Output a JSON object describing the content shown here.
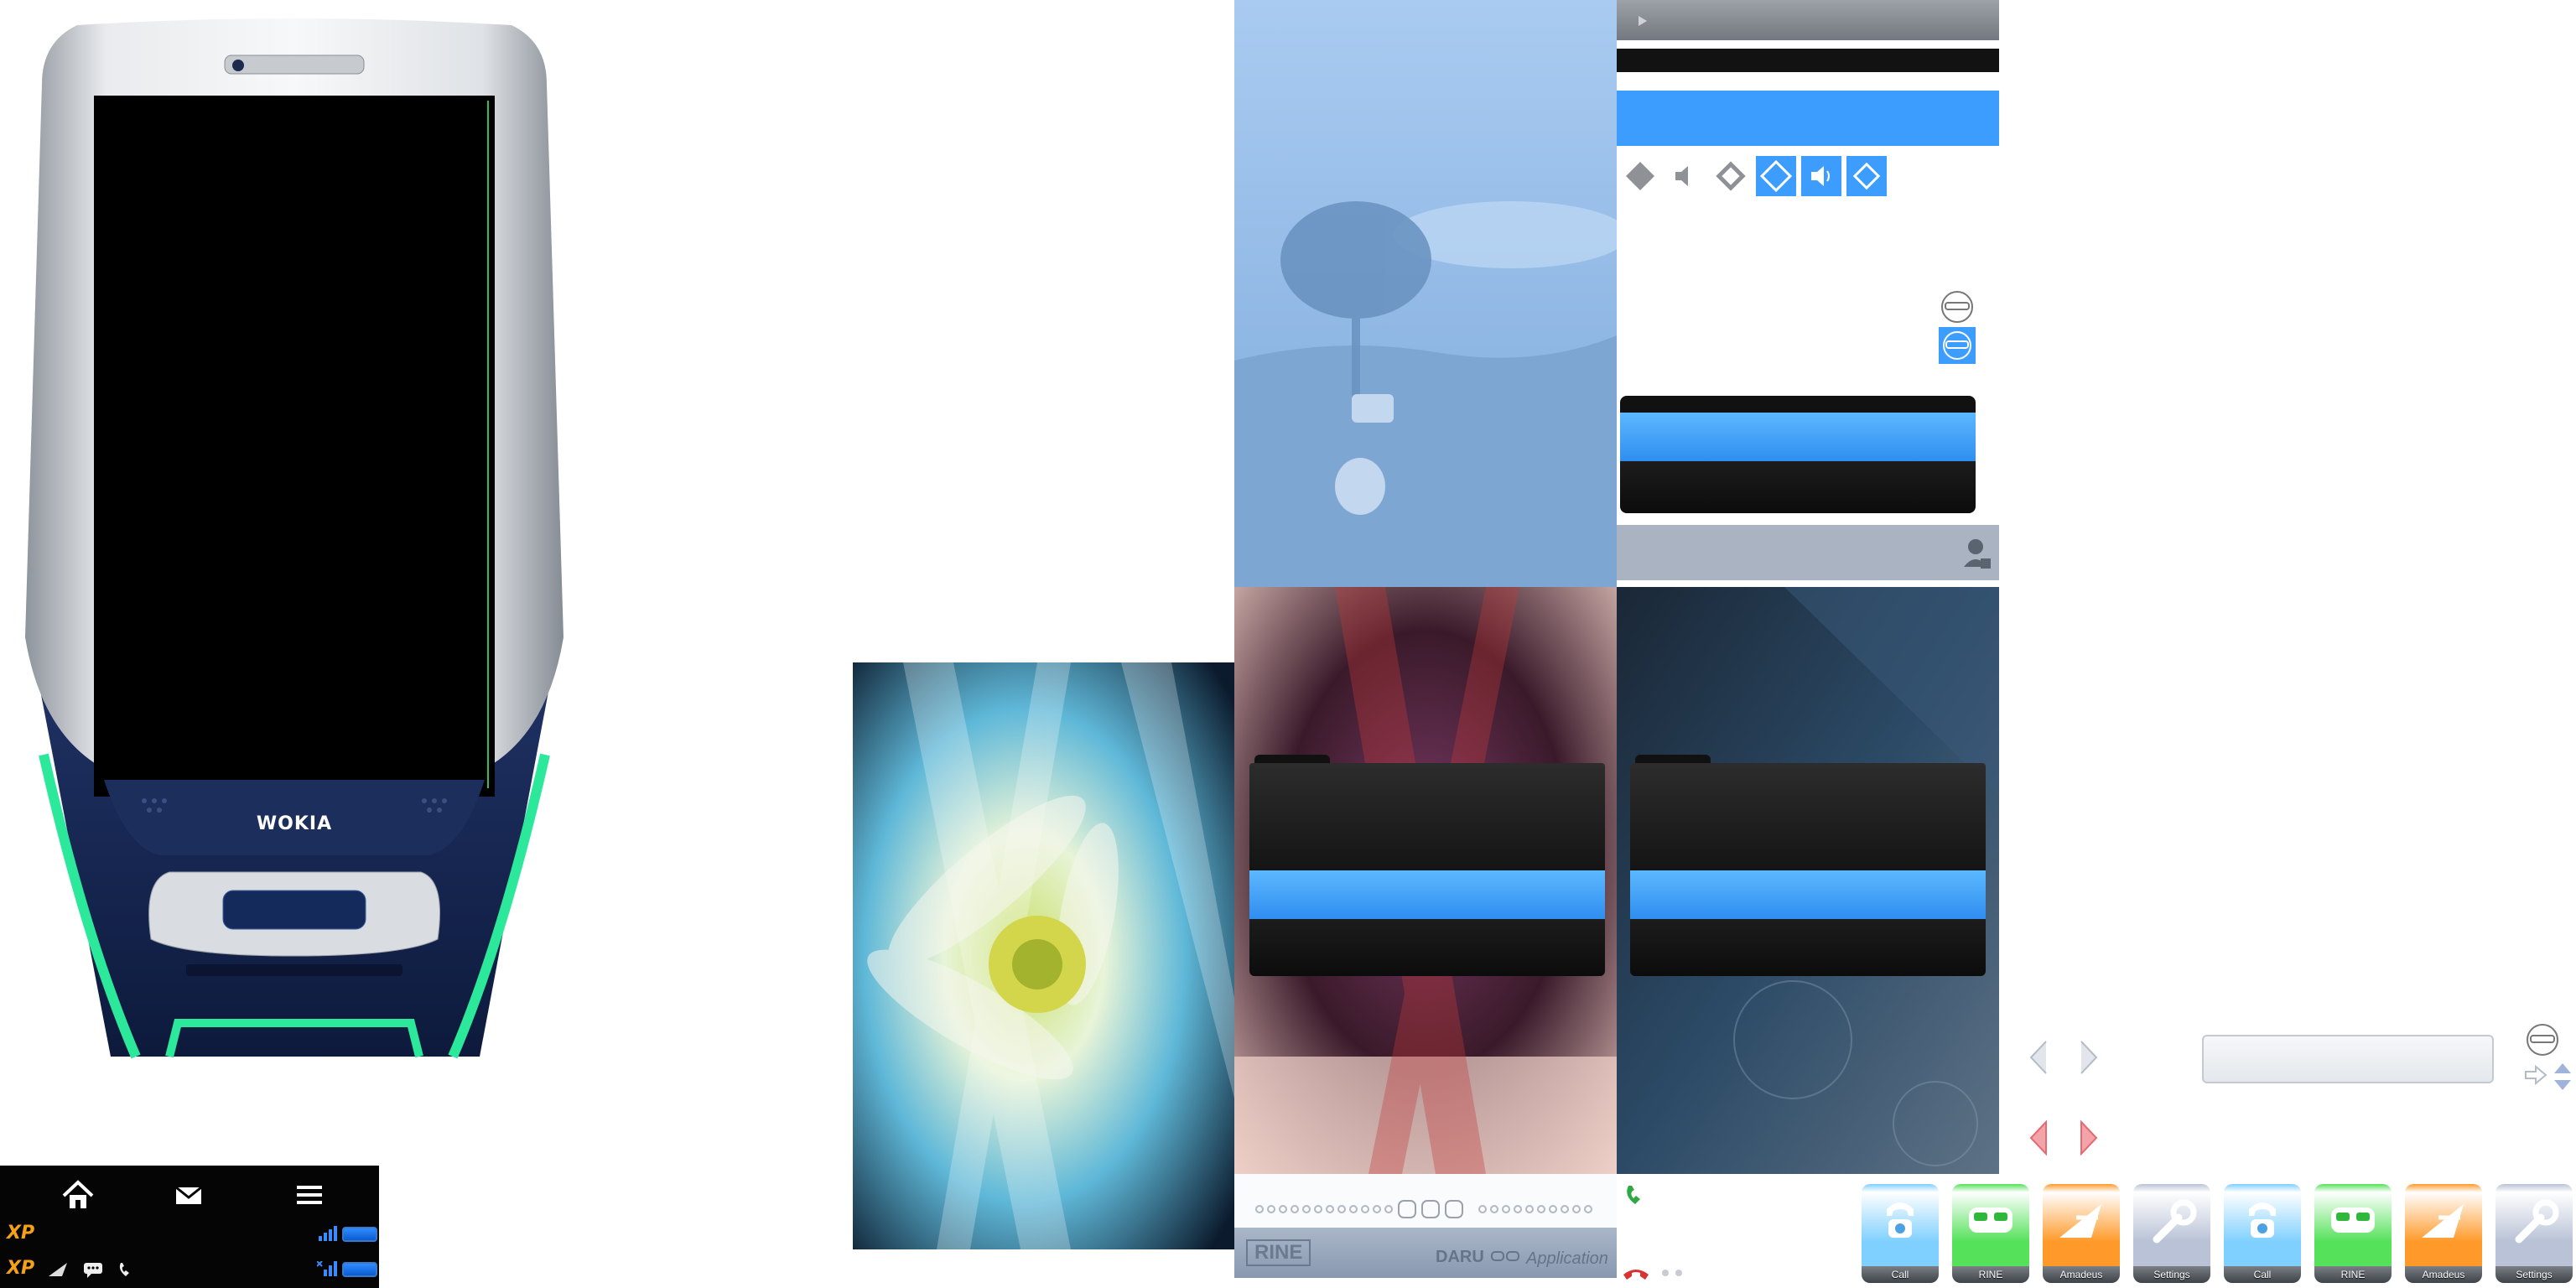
{
  "phone": {
    "brand": "WOKIA"
  },
  "taskbar": {
    "nav": [
      {
        "name": "home-icon"
      },
      {
        "name": "mail-icon"
      },
      {
        "name": "menu-icon"
      }
    ],
    "status_badge": "XP",
    "status_badge_2": "XP"
  },
  "bottom_strip": {
    "left_label": "RINE",
    "right_label": "DARU",
    "right_suffix": "Application"
  },
  "apps": [
    {
      "label": "Call",
      "color": "#7fd0ff",
      "icon": "phone-icon"
    },
    {
      "label": "RINE",
      "color": "#55e25a",
      "icon": "mask-icon"
    },
    {
      "label": "Amadeus",
      "color": "#ff9a2a",
      "icon": "amadeus-icon"
    },
    {
      "label": "Settings",
      "color": "#b9c2d6",
      "icon": "wrench-icon"
    },
    {
      "label": "Call",
      "color": "#7fd0ff",
      "icon": "phone-icon"
    },
    {
      "label": "RINE",
      "color": "#55e25a",
      "icon": "mask-icon"
    },
    {
      "label": "Amadeus",
      "color": "#ff9a2a",
      "icon": "amadeus-icon"
    },
    {
      "label": "Settings",
      "color": "#b9c2d6",
      "icon": "wrench-icon"
    }
  ],
  "colors": {
    "accent_blue": "#3c9dff",
    "phone_navy": "#17264f",
    "phone_glow": "#2ce89a",
    "sky_blue": "#7fb0e0"
  }
}
